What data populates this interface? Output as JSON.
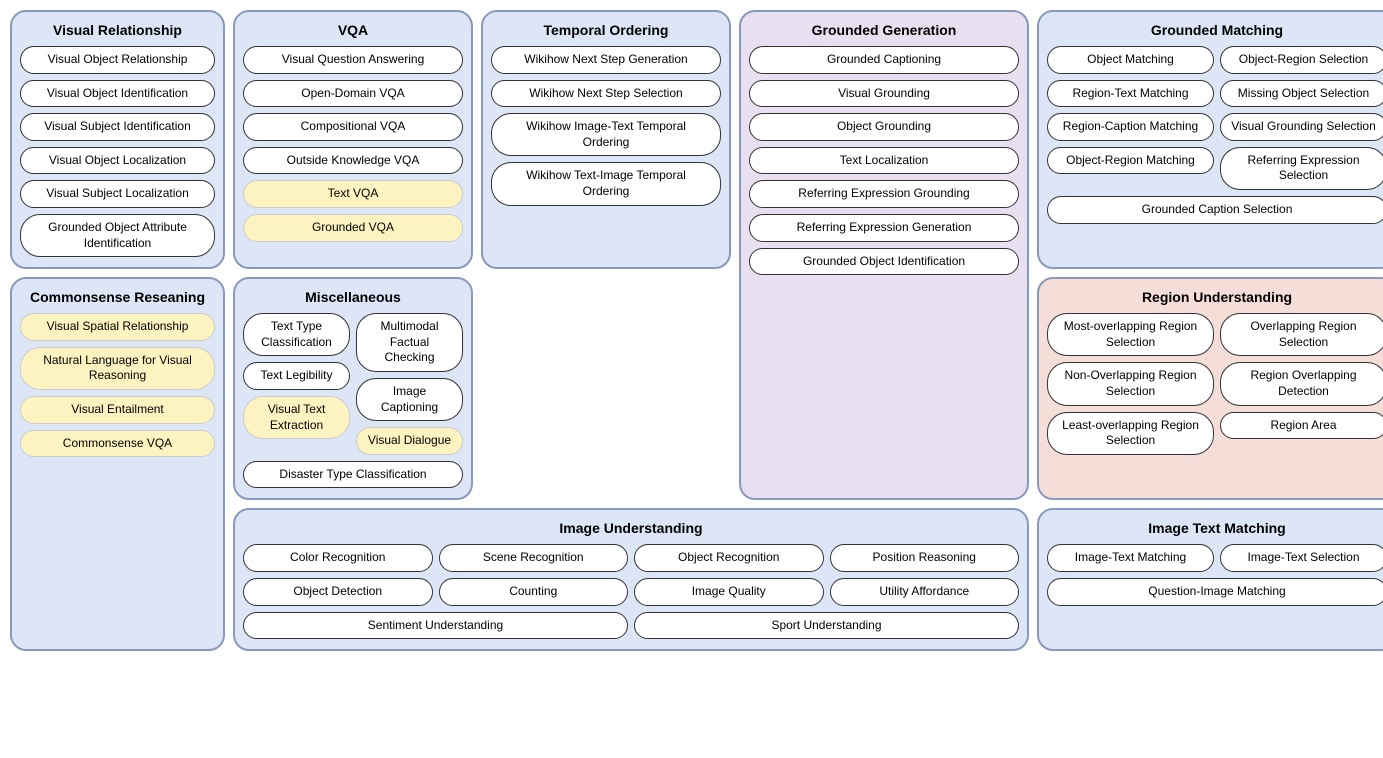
{
  "sections": {
    "visual_relationship": {
      "title": "Visual Relationship",
      "items": [
        "Visual Object Relationship",
        "Visual Object Identification",
        "Visual Subject Identification",
        "Visual Object Localization",
        "Visual Subject Localization",
        "Grounded Object Attribute Identification"
      ]
    },
    "commonsense": {
      "title": "Commonsense Reseaning",
      "items_white": [
        "Visual Spatial Relationship"
      ],
      "items_yellow": [
        "Visual Spatial Relationship",
        "Natural Language for Visual Reasoning",
        "Visual Entailment",
        "Commonsense VQA"
      ]
    },
    "vqa": {
      "title": "VQA",
      "items_white": [
        "Visual Question Answering",
        "Open-Domain VQA",
        "Compositional VQA",
        "Outside Knowledge VQA"
      ],
      "items_yellow": [
        "Text VQA",
        "Grounded VQA"
      ]
    },
    "miscellaneous": {
      "title": "Miscellaneous",
      "col1_white": [
        "Text Type Classification",
        "Text Legibility"
      ],
      "col1_yellow": [
        "Visual Text Extraction"
      ],
      "col2_white": [
        "Multimodal Factual Checking",
        "Image Captioning"
      ],
      "col2_yellow": [
        "Visual Dialogue"
      ],
      "bottom": "Disaster Type Classification"
    },
    "temporal_ordering": {
      "title": "Temporal Ordering",
      "items": [
        "Wikihow Next Step Generation",
        "Wikihow Next Step Selection",
        "Wikihow Image-Text Temporal Ordering",
        "Wikihow Text-Image Temporal Ordering"
      ]
    },
    "grounded_generation": {
      "title": "Grounded Generation",
      "items": [
        "Grounded Captioning",
        "Visual Grounding",
        "Object Grounding",
        "Text Localization",
        "Referring Expression Grounding",
        "Referring Expression Generation",
        "Grounded Object Identification"
      ]
    },
    "grounded_matching": {
      "title": "Grounded Matching",
      "col1": [
        "Object Matching",
        "Region-Text Matching",
        "Region-Caption Matching",
        "Object-Region Matching"
      ],
      "col2": [
        "Object-Region Selection",
        "Missing Object Selection",
        "Visual Grounding Selection",
        "Referring Expression Selection"
      ],
      "bottom": "Grounded Caption Selection"
    },
    "region_understanding": {
      "title": "Region Understanding",
      "col1": [
        "Most-overlapping Region Selection",
        "Non-Overlapping Region Selection",
        "Least-overlapping Region Selection"
      ],
      "col2": [
        "Overlapping Region Selection",
        "Region Overlapping Detection",
        "Region Area"
      ]
    },
    "image_understanding": {
      "title": "Image Understanding",
      "row1": [
        "Color Recognition",
        "Scene Recognition",
        "Object Recognition",
        "Position Reasoning"
      ],
      "row2": [
        "Object Detection",
        "Counting",
        "Image Quality",
        "Utility Affordance"
      ],
      "row3_left": "Sentiment Understanding",
      "row3_right": "Sport Understanding"
    },
    "image_text_matching": {
      "title": "Image Text Matching",
      "row1_left": "Image-Text Matching",
      "row1_right": "Image-Text Selection",
      "row2": "Question-Image Matching"
    }
  }
}
